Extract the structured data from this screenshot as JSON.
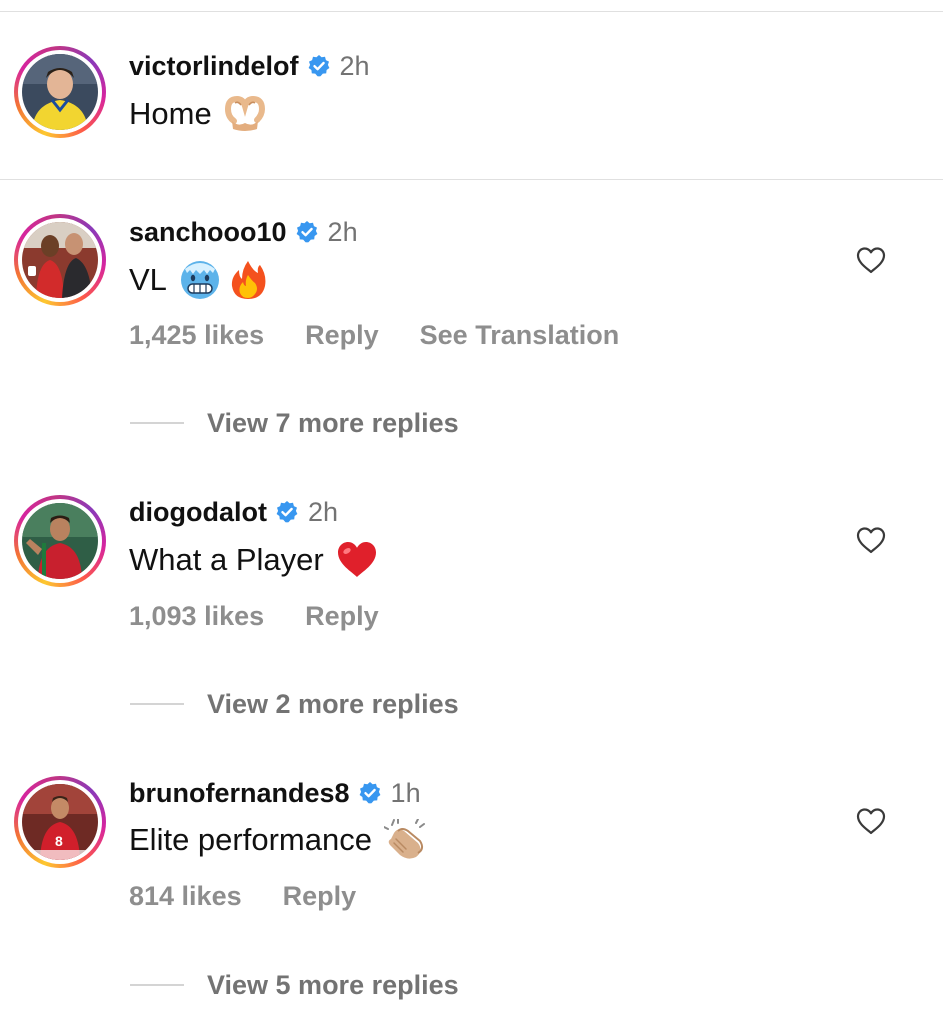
{
  "colors": {
    "verified_blue": "#3897f0",
    "secondary_text": "#737373",
    "meta_text": "#8e8e8e",
    "primary_text": "#111111"
  },
  "caption": {
    "username": "victorlindelof",
    "verified": true,
    "time": "2h",
    "text": "Home",
    "emojis": [
      "heart-hands-emoji"
    ]
  },
  "comments": [
    {
      "username": "sanchooo10",
      "verified": true,
      "time": "2h",
      "text": "VL",
      "emojis": [
        "cold-face-emoji",
        "fire-emoji"
      ],
      "likes": "1,425 likes",
      "reply_label": "Reply",
      "translation_label": "See Translation",
      "view_replies": "View 7 more replies"
    },
    {
      "username": "diogodalot",
      "verified": true,
      "time": "2h",
      "text": "What a Player",
      "emojis": [
        "red-heart-emoji"
      ],
      "likes": "1,093 likes",
      "reply_label": "Reply",
      "view_replies": "View 2 more replies"
    },
    {
      "username": "brunofernandes8",
      "verified": true,
      "time": "1h",
      "text": "Elite performance",
      "emojis": [
        "clapping-hands-emoji"
      ],
      "likes": "814 likes",
      "reply_label": "Reply",
      "view_replies": "View 5 more replies"
    }
  ]
}
